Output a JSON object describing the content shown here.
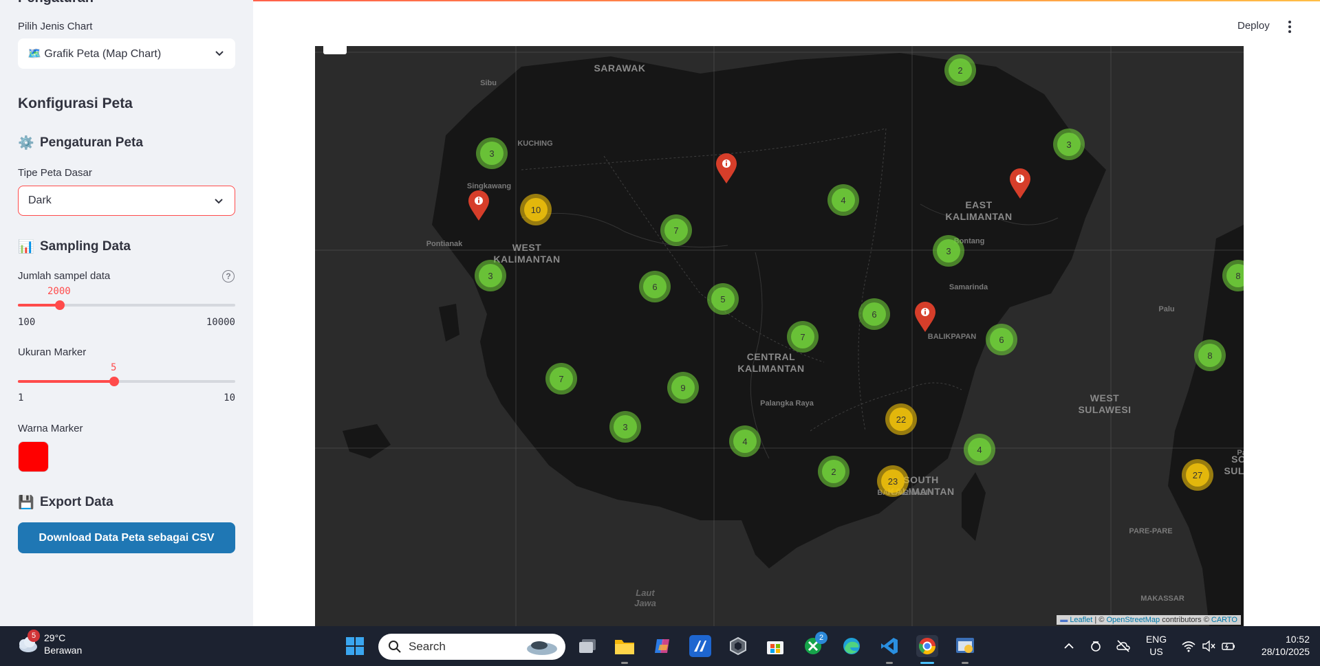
{
  "sidebar": {
    "clipped_title": "Pengaturan",
    "chart_type_label": "Pilih Jenis Chart",
    "chart_type_value": "🗺️ Grafik Peta (Map Chart)",
    "config_title": "Konfigurasi Peta",
    "map_settings_title": "Pengaturan Peta",
    "map_settings_icon": "⚙️",
    "basemap_label": "Tipe Peta Dasar",
    "basemap_value": "Dark",
    "sampling_title": "Sampling Data",
    "sampling_icon": "📊",
    "sample_label": "Jumlah sampel data",
    "sample_help": "?",
    "sample_value": "2000",
    "sample_min": "100",
    "sample_max": "10000",
    "sample_fraction": 0.1919,
    "marker_size_label": "Ukuran Marker",
    "marker_size_value": "5",
    "marker_size_min": "1",
    "marker_size_max": "10",
    "marker_size_fraction": 0.4444,
    "marker_color_label": "Warna Marker",
    "marker_color": "#ff0000",
    "export_title": "Export Data",
    "export_icon": "💾",
    "download_button": "Download Data Peta sebagai CSV"
  },
  "header": {
    "deploy": "Deploy"
  },
  "map": {
    "region_labels": [
      {
        "text": "SARAWAK"
      },
      {
        "text": "WEST\nKALIMANTAN"
      },
      {
        "text": "CENTRAL\nKALIMANTAN"
      },
      {
        "text": "EAST\nKALIMANTAN"
      },
      {
        "text": "SOUTH\nKALIMANTAN"
      },
      {
        "text": "WEST\nSULAWESI"
      },
      {
        "text": "SOU\nSULAW"
      }
    ],
    "city_labels": [
      {
        "text": "Sibu"
      },
      {
        "text": "KUCHING"
      },
      {
        "text": "Singkawang"
      },
      {
        "text": "Pontianak"
      },
      {
        "text": "Bontang"
      },
      {
        "text": "Samarinda"
      },
      {
        "text": "BALIKPAPAN"
      },
      {
        "text": "Palu"
      },
      {
        "text": "Palangka Raya"
      },
      {
        "text": "BANJARMASIN"
      },
      {
        "text": "PARE-PARE"
      },
      {
        "text": "Palo"
      },
      {
        "text": "MAKASSAR"
      },
      {
        "text": "Laut\nJawa"
      }
    ],
    "clusters": [
      {
        "count": "2",
        "color": "green"
      },
      {
        "count": "3",
        "color": "green"
      },
      {
        "count": "3",
        "color": "green"
      },
      {
        "count": "10",
        "color": "yellow"
      },
      {
        "count": "7",
        "color": "green"
      },
      {
        "count": "4",
        "color": "green"
      },
      {
        "count": "3",
        "color": "green"
      },
      {
        "count": "3",
        "color": "green"
      },
      {
        "count": "8",
        "color": "green"
      },
      {
        "count": "6",
        "color": "green"
      },
      {
        "count": "5",
        "color": "green"
      },
      {
        "count": "6",
        "color": "green"
      },
      {
        "count": "7",
        "color": "green"
      },
      {
        "count": "6",
        "color": "green"
      },
      {
        "count": "8",
        "color": "green"
      },
      {
        "count": "7",
        "color": "green"
      },
      {
        "count": "9",
        "color": "green"
      },
      {
        "count": "22",
        "color": "yellow"
      },
      {
        "count": "3",
        "color": "green"
      },
      {
        "count": "4",
        "color": "green"
      },
      {
        "count": "4",
        "color": "green"
      },
      {
        "count": "2",
        "color": "green"
      },
      {
        "count": "23",
        "color": "yellow"
      },
      {
        "count": "27",
        "color": "yellow"
      }
    ],
    "pin_count": 4,
    "attribution_leaflet": "Leaflet",
    "attribution_sep": " | © ",
    "attribution_osm": "OpenStreetMap",
    "attribution_mid": " contributors © ",
    "attribution_carto": "CARTO"
  },
  "taskbar": {
    "weather_temp": "29°C",
    "weather_desc": "Berawan",
    "weather_badge": "5",
    "search_placeholder": "Search",
    "xbox_badge": "2",
    "lang_1": "ENG",
    "lang_2": "US",
    "time": "10:52",
    "date": "28/10/2025"
  }
}
